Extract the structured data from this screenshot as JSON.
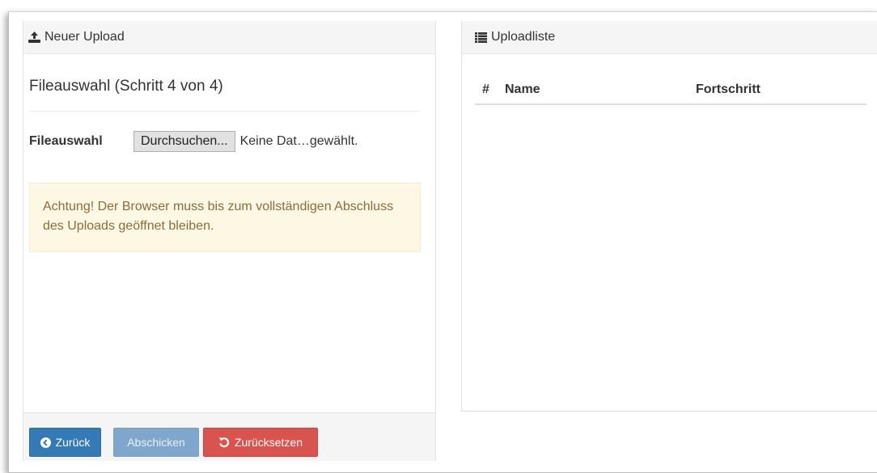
{
  "left_panel": {
    "heading": "Neuer Upload",
    "heading_icon": "upload-icon",
    "step_title": "Fileauswahl (Schritt 4 von 4)",
    "file_field": {
      "label": "Fileauswahl",
      "button_label": "Durchsuchen...",
      "status": "Keine Dat…gewählt."
    },
    "warning": "Achtung! Der Browser muss bis zum vollständigen Abschluss des Uploads geöffnet bleiben.",
    "footer": {
      "back_label": "Zurück",
      "back_icon": "circle-arrow-left-icon",
      "submit_label": "Abschicken",
      "reset_label": "Zurücksetzen",
      "reset_icon": "undo-icon"
    }
  },
  "right_panel": {
    "heading": "Uploadliste",
    "heading_icon": "list-icon",
    "table": {
      "columns": [
        "#",
        "Name",
        "Fortschritt"
      ],
      "rows": []
    }
  },
  "colors": {
    "primary": "#337ab7",
    "primary_disabled": "#7fa6cc",
    "danger": "#d9534f",
    "warning_bg": "#fcf8e3",
    "warning_text": "#8a6d3b",
    "panel_heading_bg": "#f5f5f5"
  }
}
